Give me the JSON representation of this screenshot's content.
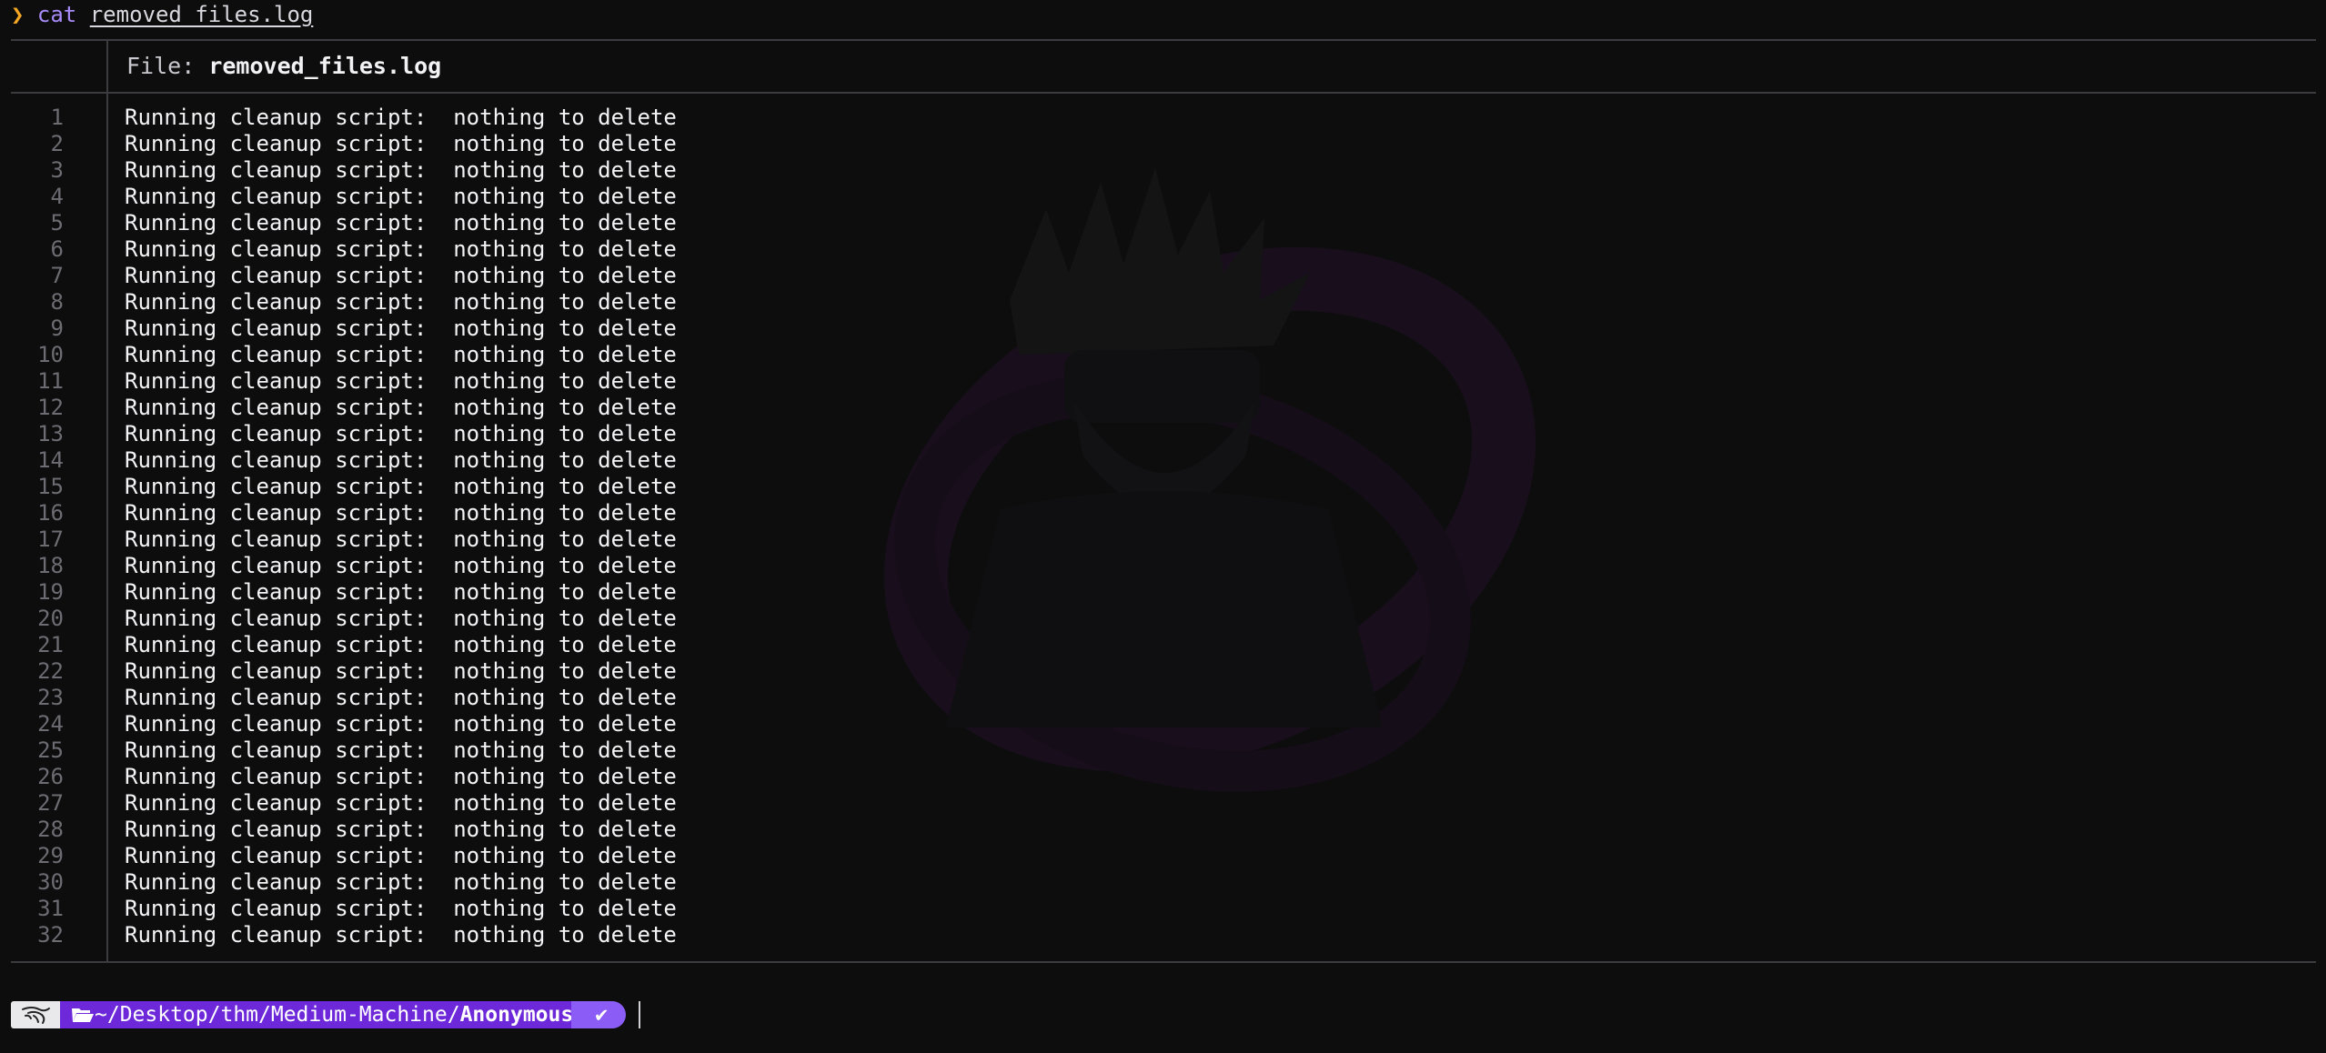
{
  "command": {
    "prompt_symbol": "❯",
    "name": "cat",
    "argument": "removed_files.log"
  },
  "viewer": {
    "header_label": "File: ",
    "file_name": "removed_files.log",
    "lines": [
      {
        "n": "1",
        "text": "Running cleanup script:  nothing to delete"
      },
      {
        "n": "2",
        "text": "Running cleanup script:  nothing to delete"
      },
      {
        "n": "3",
        "text": "Running cleanup script:  nothing to delete"
      },
      {
        "n": "4",
        "text": "Running cleanup script:  nothing to delete"
      },
      {
        "n": "5",
        "text": "Running cleanup script:  nothing to delete"
      },
      {
        "n": "6",
        "text": "Running cleanup script:  nothing to delete"
      },
      {
        "n": "7",
        "text": "Running cleanup script:  nothing to delete"
      },
      {
        "n": "8",
        "text": "Running cleanup script:  nothing to delete"
      },
      {
        "n": "9",
        "text": "Running cleanup script:  nothing to delete"
      },
      {
        "n": "10",
        "text": "Running cleanup script:  nothing to delete"
      },
      {
        "n": "11",
        "text": "Running cleanup script:  nothing to delete"
      },
      {
        "n": "12",
        "text": "Running cleanup script:  nothing to delete"
      },
      {
        "n": "13",
        "text": "Running cleanup script:  nothing to delete"
      },
      {
        "n": "14",
        "text": "Running cleanup script:  nothing to delete"
      },
      {
        "n": "15",
        "text": "Running cleanup script:  nothing to delete"
      },
      {
        "n": "16",
        "text": "Running cleanup script:  nothing to delete"
      },
      {
        "n": "17",
        "text": "Running cleanup script:  nothing to delete"
      },
      {
        "n": "18",
        "text": "Running cleanup script:  nothing to delete"
      },
      {
        "n": "19",
        "text": "Running cleanup script:  nothing to delete"
      },
      {
        "n": "20",
        "text": "Running cleanup script:  nothing to delete"
      },
      {
        "n": "21",
        "text": "Running cleanup script:  nothing to delete"
      },
      {
        "n": "22",
        "text": "Running cleanup script:  nothing to delete"
      },
      {
        "n": "23",
        "text": "Running cleanup script:  nothing to delete"
      },
      {
        "n": "24",
        "text": "Running cleanup script:  nothing to delete"
      },
      {
        "n": "25",
        "text": "Running cleanup script:  nothing to delete"
      },
      {
        "n": "26",
        "text": "Running cleanup script:  nothing to delete"
      },
      {
        "n": "27",
        "text": "Running cleanup script:  nothing to delete"
      },
      {
        "n": "28",
        "text": "Running cleanup script:  nothing to delete"
      },
      {
        "n": "29",
        "text": "Running cleanup script:  nothing to delete"
      },
      {
        "n": "30",
        "text": "Running cleanup script:  nothing to delete"
      },
      {
        "n": "31",
        "text": "Running cleanup script:  nothing to delete"
      },
      {
        "n": "32",
        "text": "Running cleanup script:  nothing to delete"
      }
    ]
  },
  "statusbar": {
    "os_icon": "kali-dragon-icon",
    "folder_icon": "folder-open-icon",
    "path_prefix": "~/Desktop/thm/Medium-Machine/",
    "path_current": "Anonymous",
    "status_glyph": "✔"
  },
  "colors": {
    "background": "#0d0d0e",
    "prompt_accent": "#f5a623",
    "command_color": "#a78bfa",
    "path_segment": "#6d28d9",
    "status_segment": "#8b5cf6"
  }
}
